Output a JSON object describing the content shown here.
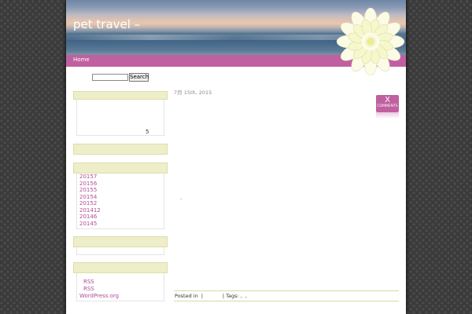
{
  "header": {
    "site_title": "pet travel –"
  },
  "nav": {
    "items": [
      {
        "label": "Home"
      }
    ]
  },
  "search": {
    "value": "",
    "button_label": "Search"
  },
  "sidebar": {
    "widget_1": {
      "text": "5"
    },
    "archives": [
      "20157",
      "20156",
      "20155",
      "20154",
      "20152",
      "201412",
      "20146",
      "20145"
    ],
    "meta_links": [
      "RSS",
      "RSS",
      "WordPress.org"
    ]
  },
  "post": {
    "date": "7月 15th, 2015",
    "comment_count": "X",
    "comment_label": "COMMENTS",
    "body_text": ".",
    "meta": "Posted in  |            | Tags: ,  ,"
  },
  "colors": {
    "accent": "#c060a0",
    "widget_header": "#eeeec8",
    "link": "#b04c97",
    "background": "#3a3a3a"
  },
  "icons": {
    "header_decoration": "dahlia-flower"
  }
}
